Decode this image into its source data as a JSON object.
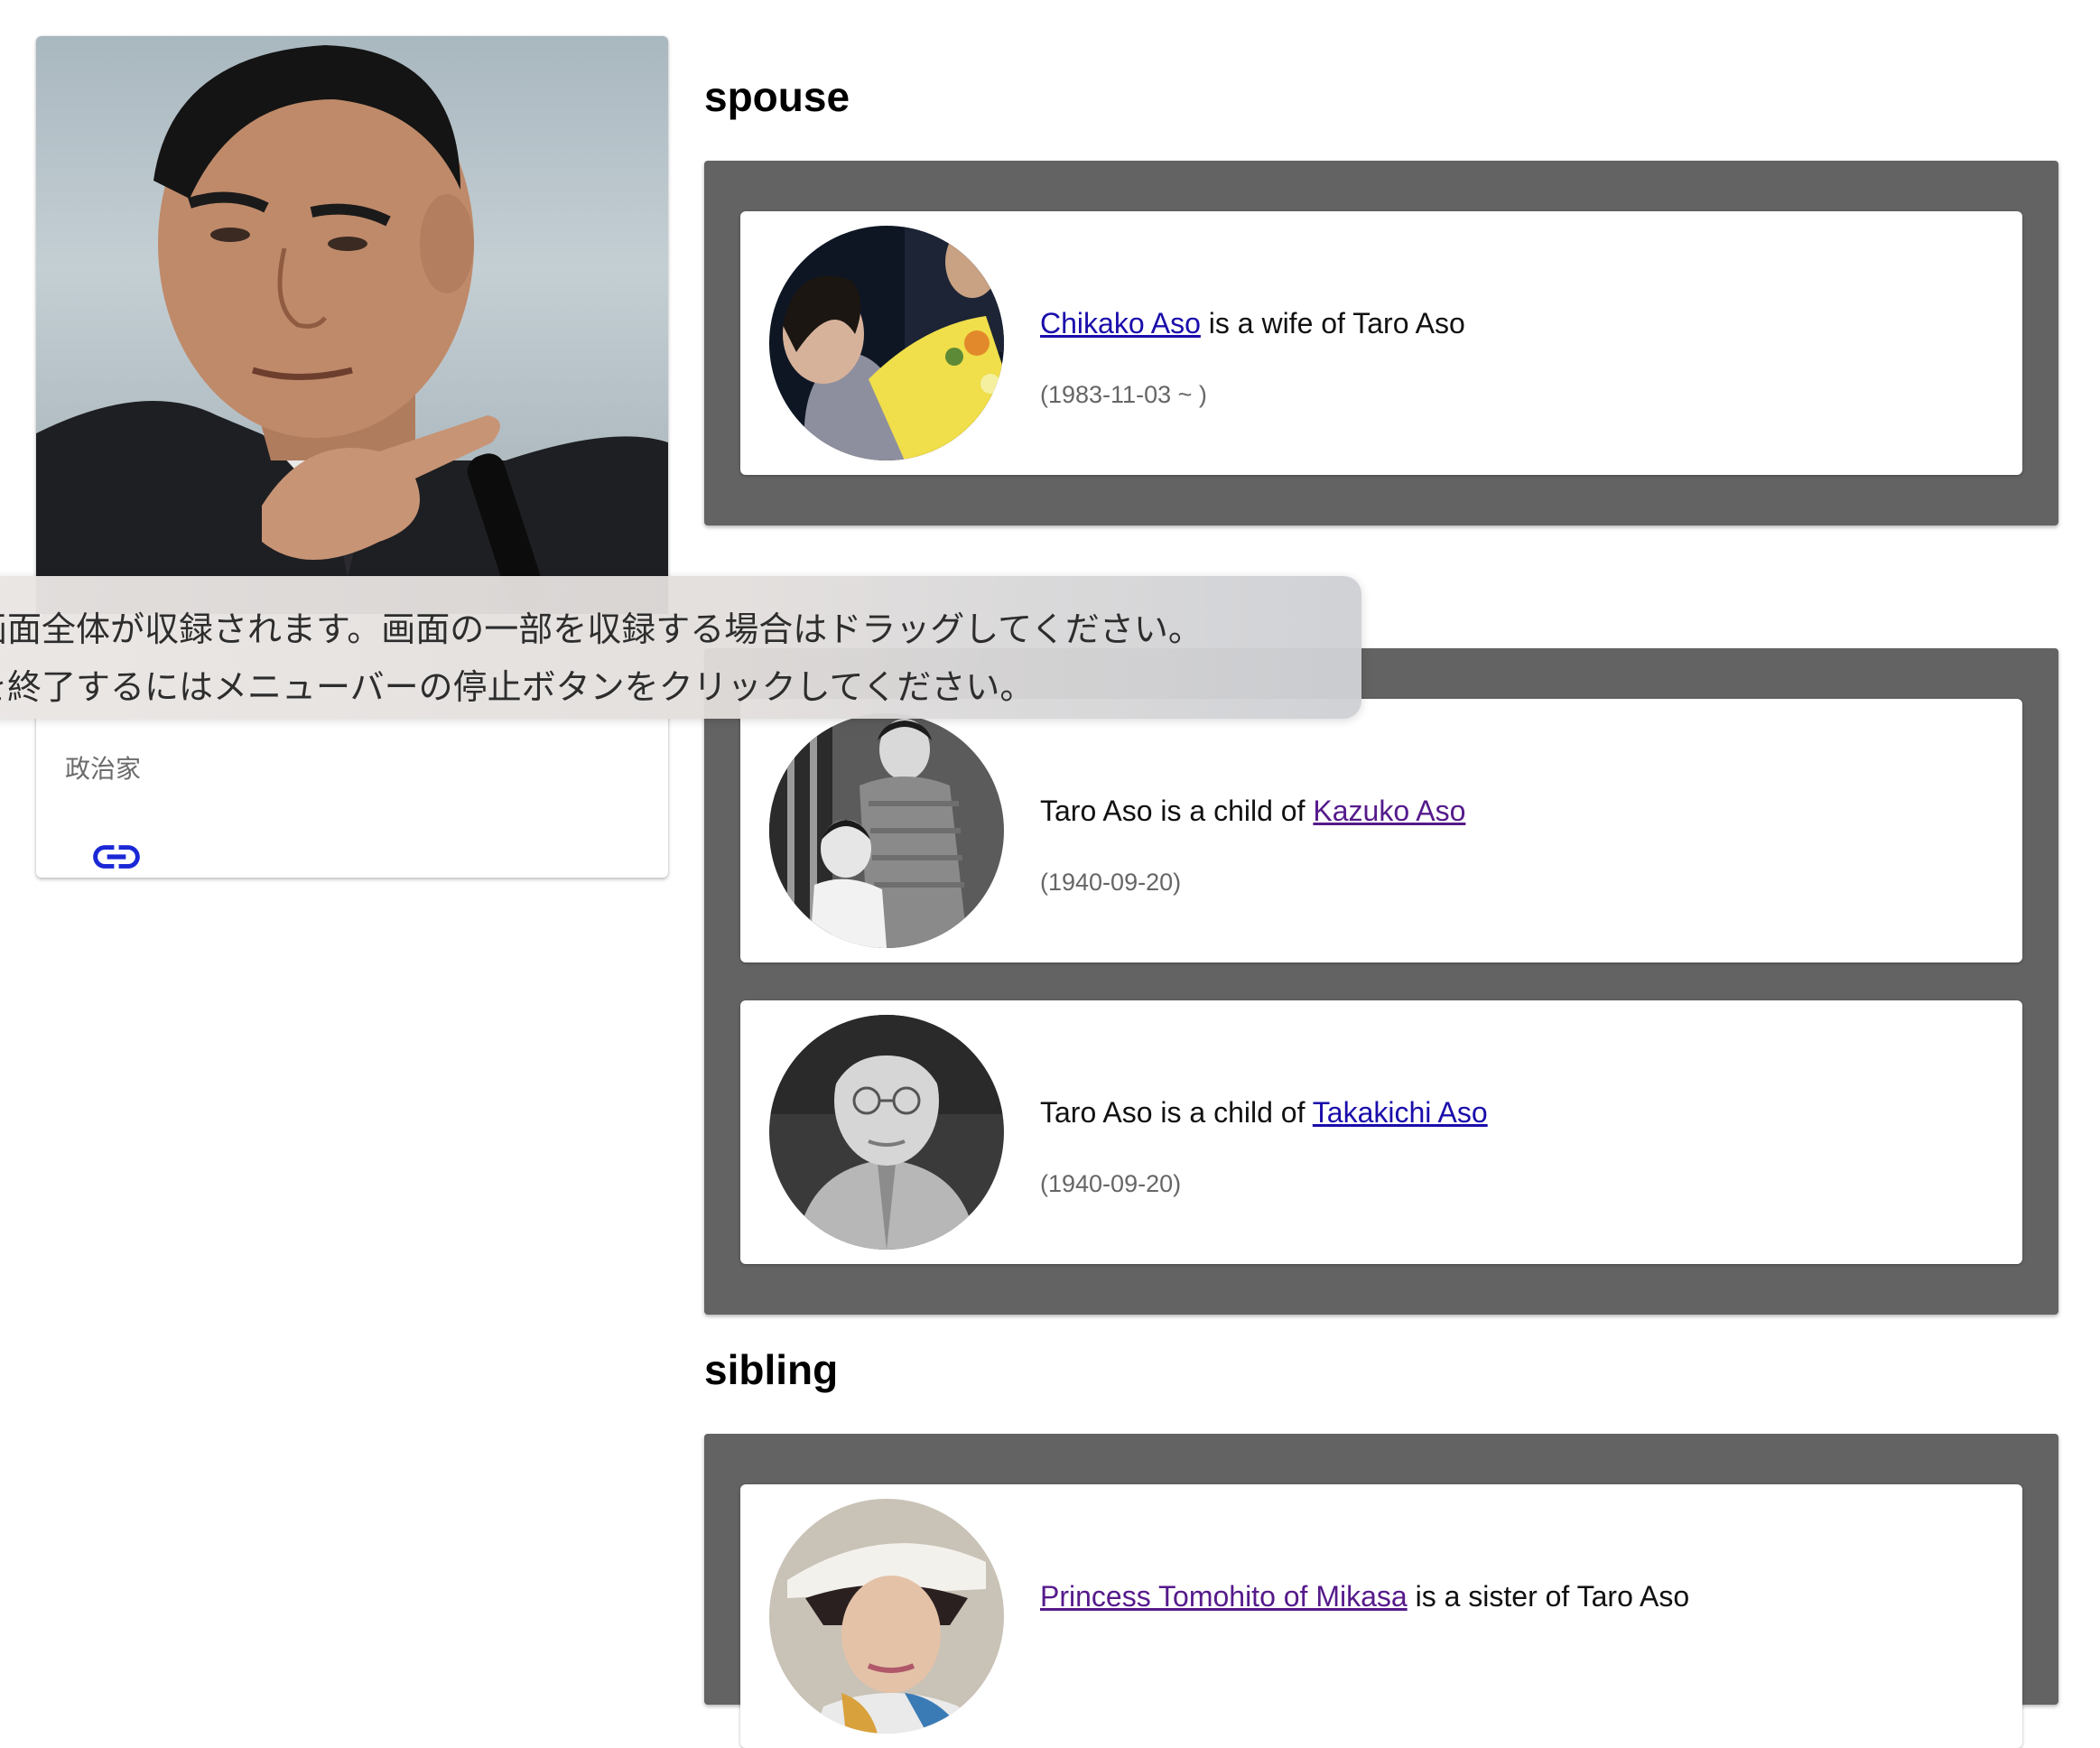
{
  "profile": {
    "occupation": "政治家",
    "link_icon": "link-icon"
  },
  "sections": {
    "spouse": {
      "title": "spouse",
      "items": [
        {
          "name": "Chikako Aso",
          "text": " is a wife of Taro Aso",
          "date": "(1983-11-03 ~ )"
        }
      ]
    },
    "parent": {
      "items": [
        {
          "prefix": "Taro Aso is a child of ",
          "name": "Kazuko Aso",
          "date": "(1940-09-20)"
        },
        {
          "prefix": "Taro Aso is a child of ",
          "name": "Takakichi Aso",
          "date": "(1940-09-20)"
        }
      ]
    },
    "sibling": {
      "title": "sibling",
      "items": [
        {
          "name": "Princess Tomohito of Mikasa",
          "text": " is a sister of Taro Aso"
        }
      ]
    }
  },
  "recording_overlay": {
    "line1": "画面全体が収録されます。画面の一部を収録する場合はドラッグしてください。",
    "line2": "を終了するにはメニューバーの停止ボタンをクリックしてください。"
  },
  "colors": {
    "group_background": "#636363",
    "link": "#1a0dab",
    "visited_link": "#551a8b"
  }
}
